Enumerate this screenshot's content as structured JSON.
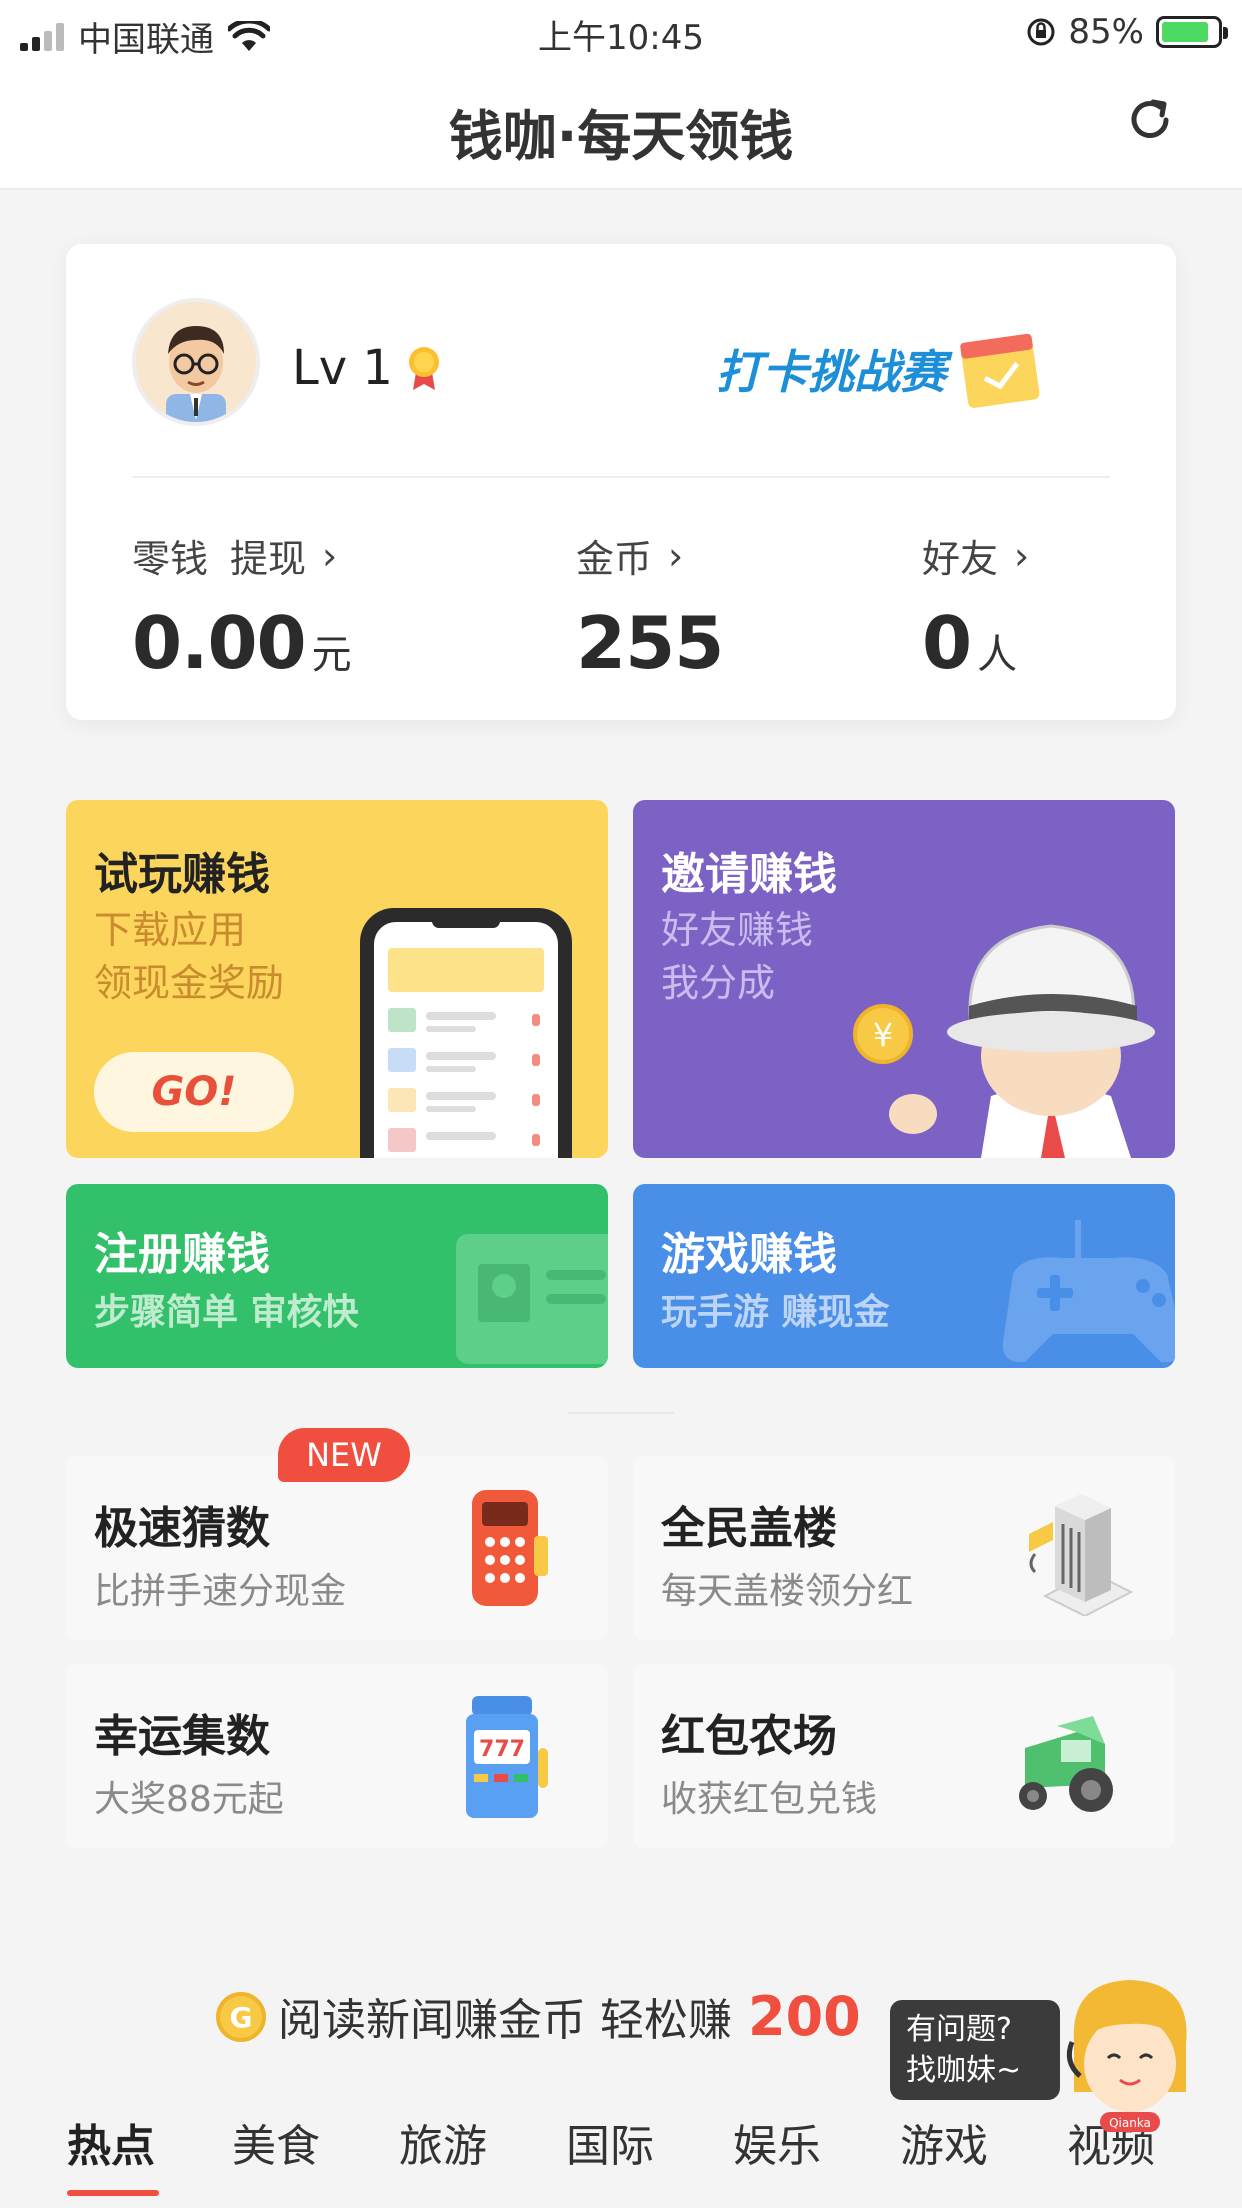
{
  "status_bar": {
    "carrier": "中国联通",
    "time": "上午10:45",
    "battery": "85%"
  },
  "nav": {
    "title": "钱咖·每天领钱"
  },
  "profile": {
    "level": "Lv 1",
    "checkin_banner": "打卡挑战赛",
    "stats": [
      {
        "label": "零钱",
        "action": "提现",
        "value": "0.00",
        "unit": "元"
      },
      {
        "label": "金币",
        "value": "255",
        "unit": ""
      },
      {
        "label": "好友",
        "value": "0",
        "unit": "人"
      }
    ]
  },
  "tiles": {
    "trial": {
      "title": "试玩赚钱",
      "sub1": "下载应用",
      "sub2": "领现金奖励",
      "button": "GO!"
    },
    "invite": {
      "title": "邀请赚钱",
      "sub1": "好友赚钱",
      "sub2": "我分成"
    },
    "register": {
      "title": "注册赚钱",
      "sub": "步骤简单 审核快"
    },
    "game": {
      "title": "游戏赚钱",
      "sub": "玩手游 赚现金"
    }
  },
  "games": [
    {
      "title": "极速猜数",
      "sub": "比拼手速分现金",
      "badge": "NEW"
    },
    {
      "title": "全民盖楼",
      "sub": "每天盖楼领分红"
    },
    {
      "title": "幸运集数",
      "sub": "大奖88元起"
    },
    {
      "title": "红包农场",
      "sub": "收获红包兑钱"
    }
  ],
  "news_banner": {
    "coin_letter": "G",
    "text": "阅读新闻赚金币 轻松赚",
    "highlight": "200"
  },
  "helper": {
    "line1": "有问题?",
    "line2": "找咖妹~",
    "mascot_label": "Qianka"
  },
  "tabs": [
    {
      "label": "热点",
      "active": true
    },
    {
      "label": "美食"
    },
    {
      "label": "旅游"
    },
    {
      "label": "国际"
    },
    {
      "label": "娱乐"
    },
    {
      "label": "游戏"
    },
    {
      "label": "视频"
    }
  ],
  "colors": {
    "accent": "#f04e3e",
    "trial": "#fcd65c",
    "invite": "#7b62c4",
    "register": "#32c06a",
    "game": "#4a8fe7"
  }
}
